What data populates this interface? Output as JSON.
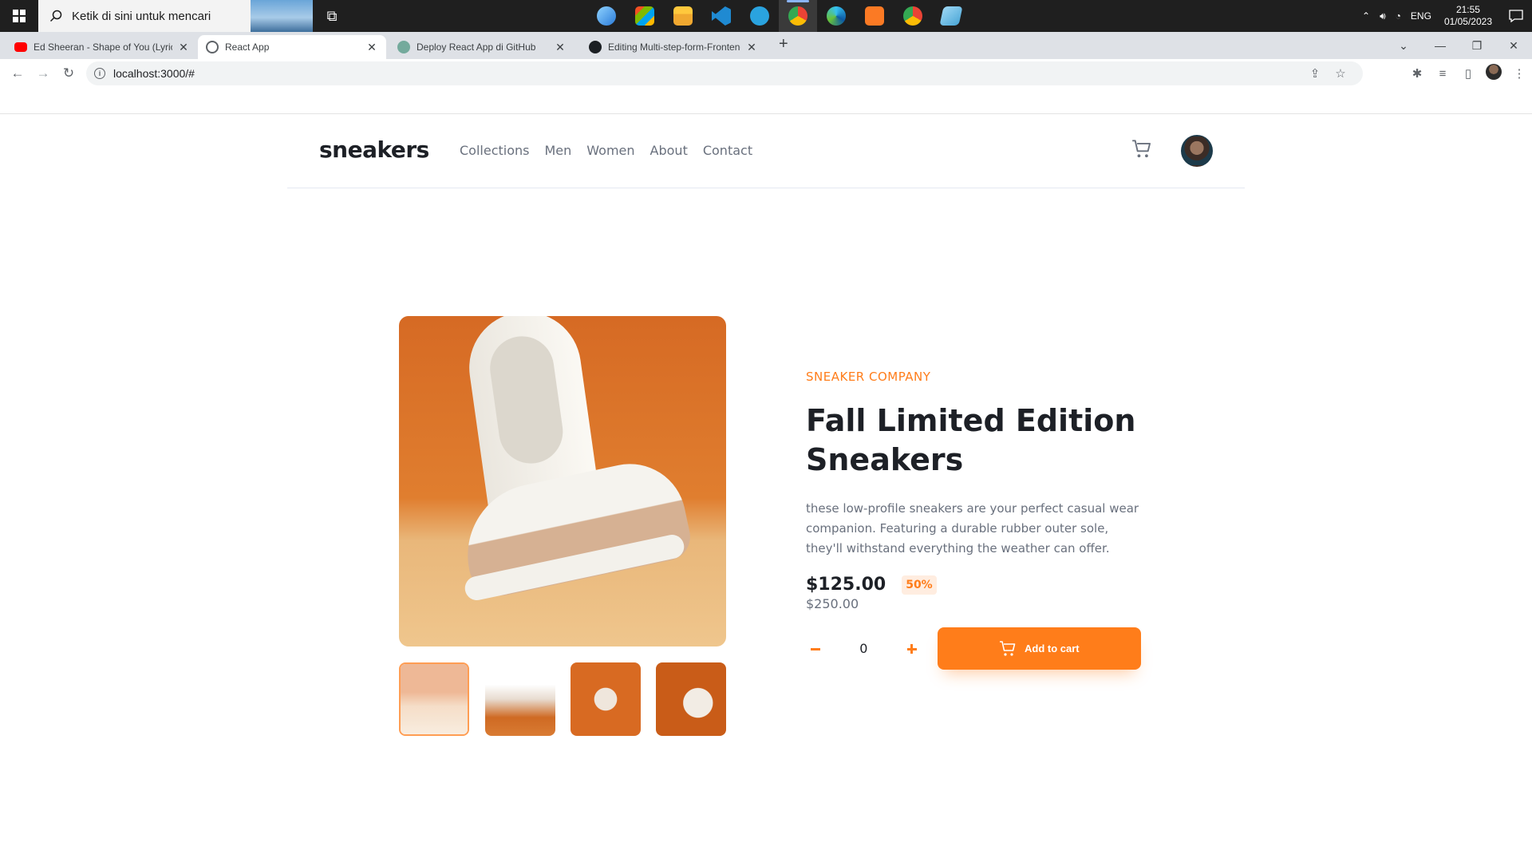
{
  "taskbar": {
    "search_placeholder": "Ketik di sini untuk mencari",
    "pinned_apps": [
      "mail-app-icon",
      "store-icon",
      "file-explorer-icon",
      "vscode-icon",
      "telegram-icon",
      "chrome-icon",
      "edge-icon",
      "xampp-icon",
      "chrome-alt-icon",
      "notepad-icon"
    ],
    "tray": {
      "language": "ENG",
      "time": "21:55",
      "date": "01/05/2023"
    }
  },
  "browser": {
    "tabs": [
      {
        "title": "Ed Sheeran - Shape of You (Lyrics",
        "favicon": "youtube-icon"
      },
      {
        "title": "React App",
        "favicon": "globe-icon"
      },
      {
        "title": "Deploy React App di GitHub",
        "favicon": "chatgpt-icon"
      },
      {
        "title": "Editing Multi-step-form-Frontend",
        "favicon": "github-icon"
      }
    ],
    "url": "localhost:3000/#"
  },
  "site": {
    "logo": "sneakers",
    "nav": [
      "Collections",
      "Men",
      "Women",
      "About",
      "Contact"
    ]
  },
  "product": {
    "company": "SNEAKER COMPANY",
    "title": "Fall Limited Edition Sneakers",
    "description": "these low-profile sneakers are your perfect casual wear companion. Featuring a durable rubber outer sole, they'll withstand everything the weather can offer.",
    "price": "$125.00",
    "discount": "50%",
    "original_price": "$250.00",
    "quantity": "0",
    "add_to_cart_label": "Add to cart"
  },
  "colors": {
    "accent": "#ff7d1a",
    "accent_pale": "#ffede0",
    "text_dark": "#1d2026",
    "text_muted": "#69707d"
  }
}
